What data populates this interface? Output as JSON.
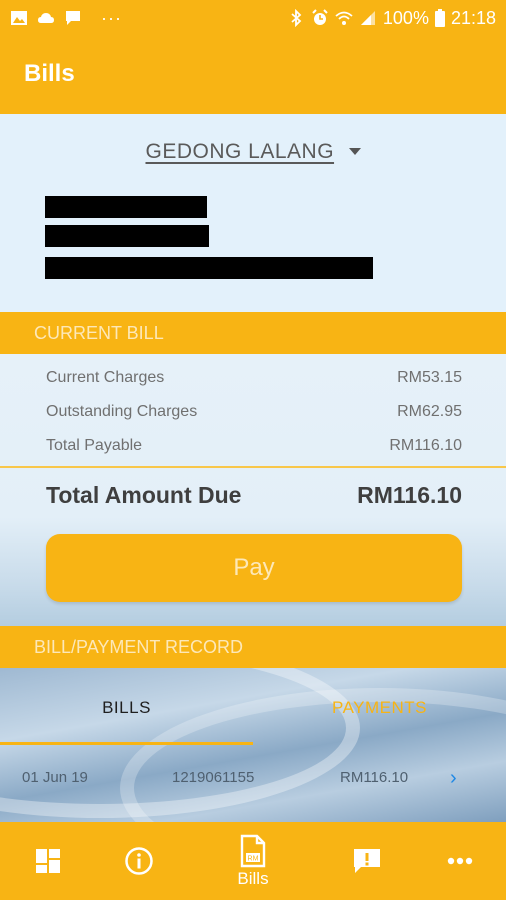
{
  "status_bar": {
    "left_icons": [
      "image-icon",
      "cloud-icon",
      "message-icon"
    ],
    "more": "···",
    "battery": "100%",
    "time": "21:18"
  },
  "app_bar": {
    "title": "Bills"
  },
  "account": {
    "location": "GEDONG LALANG"
  },
  "current_bill": {
    "section_title": "CURRENT BILL",
    "rows": [
      {
        "label": "Current Charges",
        "value": "RM53.15"
      },
      {
        "label": "Outstanding Charges",
        "value": "RM62.95"
      },
      {
        "label": "Total Payable",
        "value": "RM116.10"
      }
    ],
    "total_label": "Total Amount Due",
    "total_value": "RM116.10",
    "pay_label": "Pay"
  },
  "record": {
    "section_title": "BILL/PAYMENT RECORD",
    "tabs": [
      {
        "label": "BILLS",
        "active": true
      },
      {
        "label": "PAYMENTS",
        "active": false
      }
    ],
    "rows": [
      {
        "date": "01 Jun 19",
        "number": "1219061155",
        "amount": "RM116.10"
      }
    ]
  },
  "bottom_nav": {
    "items": [
      {
        "icon": "dashboard-icon",
        "label": ""
      },
      {
        "icon": "info-icon",
        "label": ""
      },
      {
        "icon": "bill-document-icon",
        "label": "Bills",
        "badge": "RM"
      },
      {
        "icon": "report-icon",
        "label": ""
      },
      {
        "icon": "more-icon",
        "label": ""
      }
    ]
  },
  "colors": {
    "accent": "#f8b414",
    "account_bg": "#e3f1fb",
    "tab_indicator": "#f8b414",
    "chevron": "#1e88e5"
  }
}
